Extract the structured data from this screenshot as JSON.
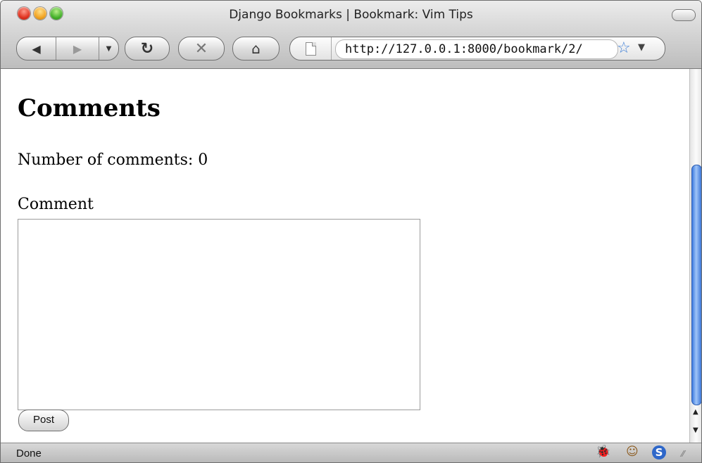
{
  "window": {
    "title": "Django Bookmarks | Bookmark: Vim Tips"
  },
  "toolbar": {
    "url": "http://127.0.0.1:8000/bookmark/2/"
  },
  "page": {
    "heading": "Comments",
    "count_line": "Number of comments: 0",
    "comment_label": "Comment",
    "comment_value": "",
    "post_label": "Post"
  },
  "statusbar": {
    "text": "Done"
  },
  "colors": {
    "scroll_thumb": "#3e7be0",
    "bookmark_star": "#3f7fd6"
  },
  "icons": [
    "close-button",
    "minimize-button",
    "zoom-button",
    "back-icon",
    "forward-icon",
    "history-dropdown-icon",
    "reload-icon",
    "stop-icon",
    "home-icon",
    "page-icon",
    "bookmark-star-icon",
    "url-dropdown-icon",
    "firebug-icon",
    "greasemonkey-icon",
    "skype-icon",
    "resize-grip-icon"
  ]
}
